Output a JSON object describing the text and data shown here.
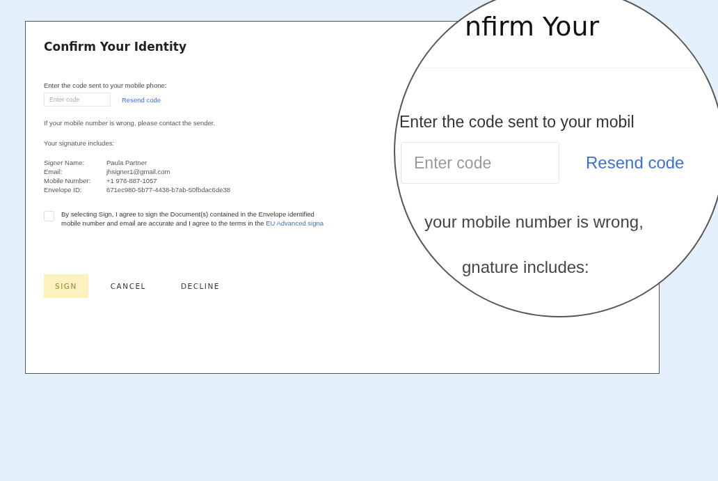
{
  "dialog": {
    "title": "Confirm Your Identity",
    "code_label": "Enter the code sent to your mobile phone:",
    "code_field": {
      "placeholder": "Enter code"
    },
    "resend_link": "Resend code",
    "wrong_number_note": "If your mobile number is wrong, please contact the sender.",
    "signature_heading": "Your signature includes:",
    "details": [
      {
        "label": "Signer Name:",
        "value": "Paula Partner"
      },
      {
        "label": "Email:",
        "value": "jhsigner1@gmail.com"
      },
      {
        "label": "Mobile Number:",
        "value": "+1 978-887-1057"
      },
      {
        "label": "Envelope ID:",
        "value": "671ec980-5b77-4438-b7ab-50fbdac6de38"
      }
    ],
    "agreement": {
      "checked": false,
      "line_1": "By selecting Sign, I agree to sign the Document(s) contained in the Envelope identified",
      "line_2": "mobile number and email are accurate and I agree to the terms in the",
      "link": "EU Advanced signa"
    },
    "buttons": [
      {
        "label": "SIGN",
        "kind": "primary",
        "disabled": true
      },
      {
        "label": "CANCEL",
        "kind": "text",
        "disabled": false
      },
      {
        "label": "DECLINE",
        "kind": "text",
        "disabled": false
      }
    ]
  },
  "magnifier": {
    "title": "nfirm Your",
    "code_label": "Enter the code sent to your mobil",
    "code_field": {
      "placeholder": "Enter code"
    },
    "resend_link": "Resend code",
    "wrong_number_note": "your mobile number is wrong,",
    "signature_heading": "gnature includes:"
  }
}
